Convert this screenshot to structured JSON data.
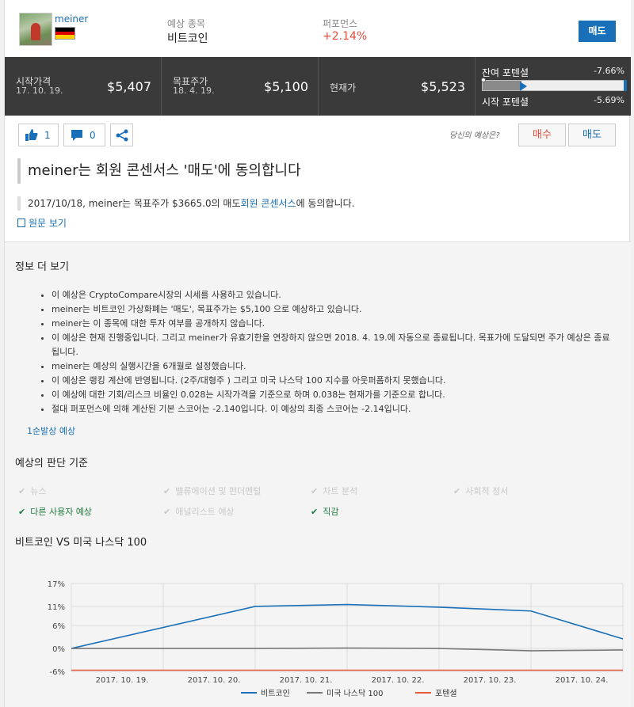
{
  "header": {
    "user_name": "meiner",
    "flag_colors": [
      "#000000",
      "#dd0000",
      "#ffce00"
    ],
    "asset_label": "예상 종목",
    "asset_value": "비트코인",
    "perf_label": "퍼포먼스",
    "perf_value": "+2.14%",
    "sell_button": "매도"
  },
  "stats": {
    "start_label": "시작가격",
    "start_date": "17. 10. 19.",
    "start_value": "$5,407",
    "target_label": "목표주가",
    "target_date": "18. 4. 19.",
    "target_value": "$5,100",
    "current_label": "현재가",
    "current_value": "$5,523",
    "remaining_label": "잔여 포텐셜",
    "remaining_value": "-7.66%",
    "start_pot_label": "시작 포텐셜",
    "start_pot_value": "-5.69%",
    "progress": 0.27
  },
  "actions": {
    "like_count": "1",
    "comment_count": "0",
    "question": "당신의 예상은?",
    "buy_label": "매수",
    "sell_label": "매도"
  },
  "headline": "meiner는 회원 콘센서스 '매도'에 동의합니다",
  "agree": {
    "prefix": "2017/10/18, meiner는 목표주가 $3665.0의 매도",
    "link": "회원 콘센서스",
    "suffix": "에 동의합니다."
  },
  "original_link": "원문 보기",
  "more_info": {
    "title": "정보 더 보기",
    "items": [
      "이 예상은 CryptoCompare시장의 시세를 사용하고 있습니다.",
      "meiner는 비트코인 가상화폐는 '매도', 목표주가는 $5,100 으로 예상하고 있습니다.",
      "meiner는 이 종목에 대한 투자 여부를 공개하지 않습니다.",
      "이 예상은 현재 진행중입니다. 그리고 meiner가 유효기한을 연장하지 않으면 2018. 4. 19.에 자동으로 종료됩니다. 목표가에 도달되면 주가 예상은 종료됩니다.",
      "meiner는 예상의 실행시간을 6개월로 설정했습니다.",
      "이 예상은 랭킹 계산에 반영됩니다. (2주/대형주 ) 그리고 미국 나스닥 100 지수를 아웃퍼폼하지 못했습니다.",
      "이 예상에 대한 기회/리스크 비율인 0.028는 시작가격을 기준으로 하며 0.038는 현재가를 기준으로 합니다.",
      "절대 퍼포먼스에 의해 계산된 기본 스코어는 -2.140입니다. 이 예상의 최종 스코어는 -2.14입니다."
    ],
    "rank_link": "1순발상 예상"
  },
  "criteria": {
    "title": "예상의 판단 기준",
    "items": [
      {
        "label": "뉴스",
        "active": false
      },
      {
        "label": "밸류에이션 및 펀더멘털",
        "active": false
      },
      {
        "label": "차트 분석",
        "active": false
      },
      {
        "label": "사회적 정서",
        "active": false
      },
      {
        "label": "다른 사용자 예상",
        "active": true
      },
      {
        "label": "애널리스트 예상",
        "active": false
      },
      {
        "label": "직감",
        "active": true
      }
    ]
  },
  "chart_data": {
    "type": "line",
    "title": "비트코인 VS 미국 나스닥 100",
    "x": [
      "2017. 10. 19.",
      "2017. 10. 20.",
      "2017. 10. 21.",
      "2017. 10. 22.",
      "2017. 10. 23.",
      "2017. 10. 24."
    ],
    "yticks": [
      "17%",
      "11%",
      "6%",
      "0%",
      "-6%"
    ],
    "ylim": [
      -6,
      17
    ],
    "series": [
      {
        "name": "비트코인",
        "color": "#1a6fb9",
        "points": [
          [
            0,
            0
          ],
          [
            2,
            11
          ],
          [
            3,
            11.5
          ],
          [
            4,
            10.8
          ],
          [
            5,
            9.8
          ],
          [
            6,
            2.5
          ]
        ]
      },
      {
        "name": "미국 나스닥 100",
        "color": "#777777",
        "points": [
          [
            0,
            0
          ],
          [
            2,
            0
          ],
          [
            3,
            0.1
          ],
          [
            4,
            0
          ],
          [
            5,
            -0.6
          ],
          [
            6,
            -0.4
          ]
        ]
      },
      {
        "name": "포텐셜",
        "color": "#e8593a",
        "points": [
          [
            0,
            -5.69
          ],
          [
            6,
            -5.69
          ]
        ]
      }
    ],
    "grid": true,
    "legend": "bottom"
  }
}
